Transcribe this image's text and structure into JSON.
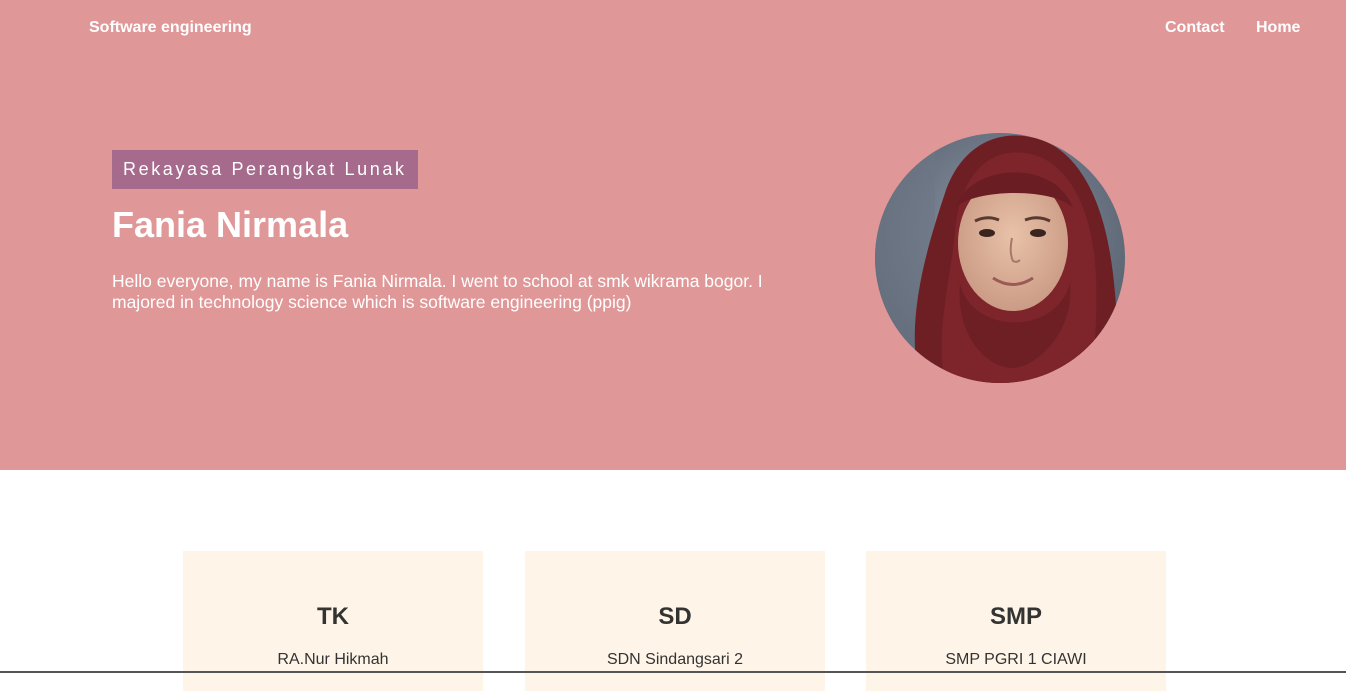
{
  "navbar": {
    "brand": "Software engineering",
    "links": [
      {
        "label": "Contact"
      },
      {
        "label": "Home"
      }
    ]
  },
  "hero": {
    "badge": "Rekayasa Perangkat Lunak",
    "name": "Fania Nirmala",
    "intro": "Hello everyone, my name is Fania Nirmala. I went to school at smk wikrama bogor. I majored in technology science which is software engineering (ppig)",
    "background_color": "#e09797",
    "badge_color": "#a66a8c"
  },
  "education": {
    "card_color": "#fef5e8",
    "cards": [
      {
        "level": "TK",
        "school": "RA.Nur Hikmah"
      },
      {
        "level": "SD",
        "school": "SDN Sindangsari 2"
      },
      {
        "level": "SMP",
        "school": "SMP PGRI 1 CIAWI"
      }
    ]
  }
}
